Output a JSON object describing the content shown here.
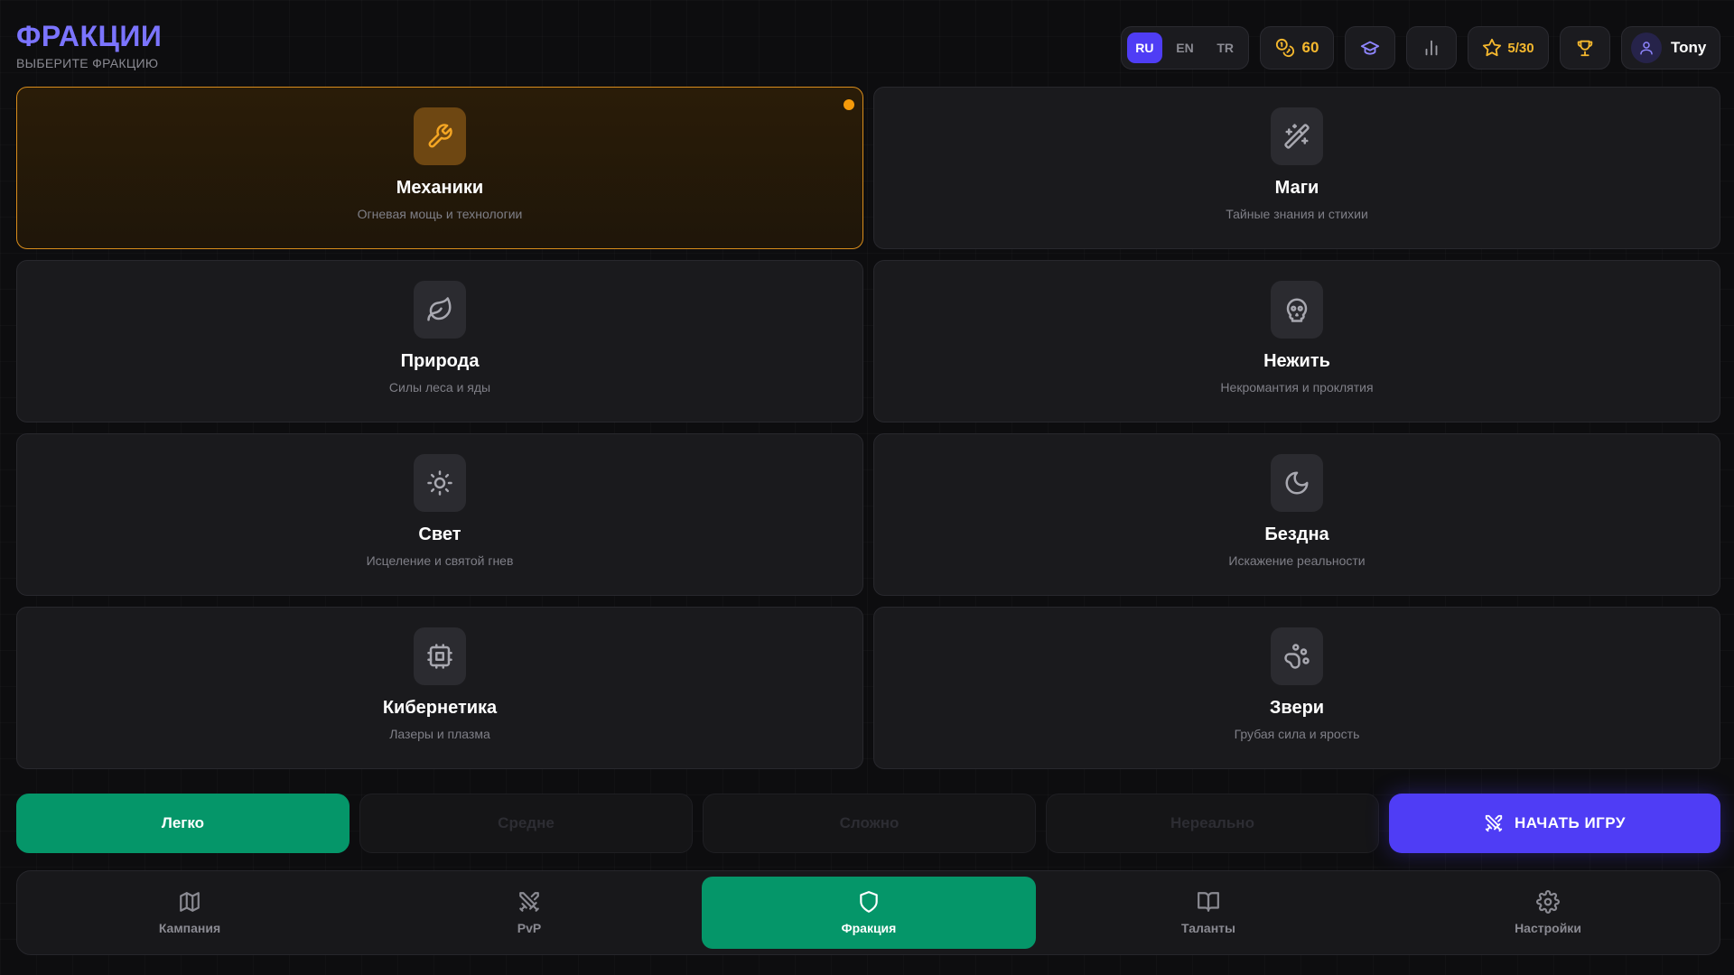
{
  "header": {
    "title": "ФРАКЦИИ",
    "subtitle": "ВЫБЕРИТЕ ФРАКЦИЮ"
  },
  "topbar": {
    "languages": [
      {
        "code": "RU",
        "active": true
      },
      {
        "code": "EN",
        "active": false
      },
      {
        "code": "TR",
        "active": false
      }
    ],
    "coins": "60",
    "stars": "5/30",
    "username": "Tony",
    "icons": {
      "coins": "coins-icon",
      "academy": "graduation-cap-icon",
      "stats": "bar-chart-icon",
      "stars": "star-icon",
      "trophy": "trophy-icon",
      "avatar": "user-icon"
    }
  },
  "factions": [
    {
      "name": "Механики",
      "desc": "Огневая мощь и технологии",
      "icon": "wrench-icon",
      "selected": true
    },
    {
      "name": "Маги",
      "desc": "Тайные знания и стихии",
      "icon": "magic-wand-icon",
      "selected": false
    },
    {
      "name": "Природа",
      "desc": "Силы леса и яды",
      "icon": "leaf-icon",
      "selected": false
    },
    {
      "name": "Нежить",
      "desc": "Некромантия и проклятия",
      "icon": "skull-icon",
      "selected": false
    },
    {
      "name": "Свет",
      "desc": "Исцеление и святой гнев",
      "icon": "sun-icon",
      "selected": false
    },
    {
      "name": "Бездна",
      "desc": "Искажение реальности",
      "icon": "moon-icon",
      "selected": false
    },
    {
      "name": "Кибернетика",
      "desc": "Лазеры и плазма",
      "icon": "cpu-icon",
      "selected": false
    },
    {
      "name": "Звери",
      "desc": "Грубая сила и ярость",
      "icon": "paw-icon",
      "selected": false
    }
  ],
  "difficulty": {
    "options": [
      "Легко",
      "Средне",
      "Сложно",
      "Нереально"
    ],
    "selected": "Легко"
  },
  "start_button": {
    "label": "НАЧАТЬ ИГРУ",
    "icon": "crossed-swords-icon"
  },
  "nav": {
    "items": [
      {
        "label": "Кампания",
        "icon": "map-icon",
        "active": false
      },
      {
        "label": "PvP",
        "icon": "crossed-swords-icon",
        "active": false
      },
      {
        "label": "Фракция",
        "icon": "shield-icon",
        "active": true
      },
      {
        "label": "Таланты",
        "icon": "book-icon",
        "active": false
      },
      {
        "label": "Настройки",
        "icon": "gear-icon",
        "active": false
      }
    ]
  },
  "colors": {
    "accent_purple": "#4f3df5",
    "title_purple": "#7b74ff",
    "selected_orange": "#f59a0a",
    "active_green": "#059669",
    "gold": "#f5b82e"
  }
}
